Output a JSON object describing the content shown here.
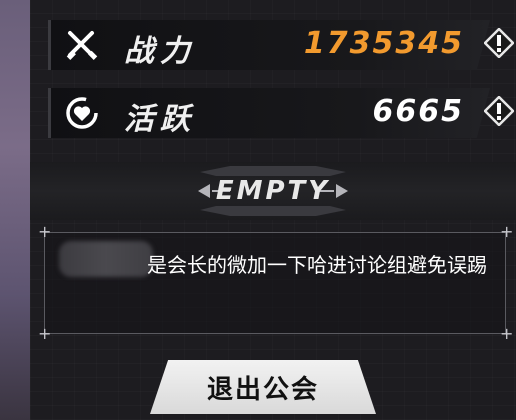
{
  "stats": {
    "power": {
      "label": "战力",
      "value": "1735345",
      "icon": "crossed-swords-icon",
      "info_icon": "exclamation-info-icon"
    },
    "activity": {
      "label": "活跃",
      "value": "6665",
      "icon": "heart-refresh-icon",
      "info_icon": "exclamation-info-icon"
    }
  },
  "badge": {
    "text": "EMPTY"
  },
  "notice": {
    "text": "是会长的微加一下哈进讨论组避免误踢"
  },
  "actions": {
    "quit_label": "退出公会"
  },
  "colors": {
    "power_value": "#f29a2e",
    "activity_value": "#ffffff",
    "panel_bg": "#1d1c20"
  }
}
